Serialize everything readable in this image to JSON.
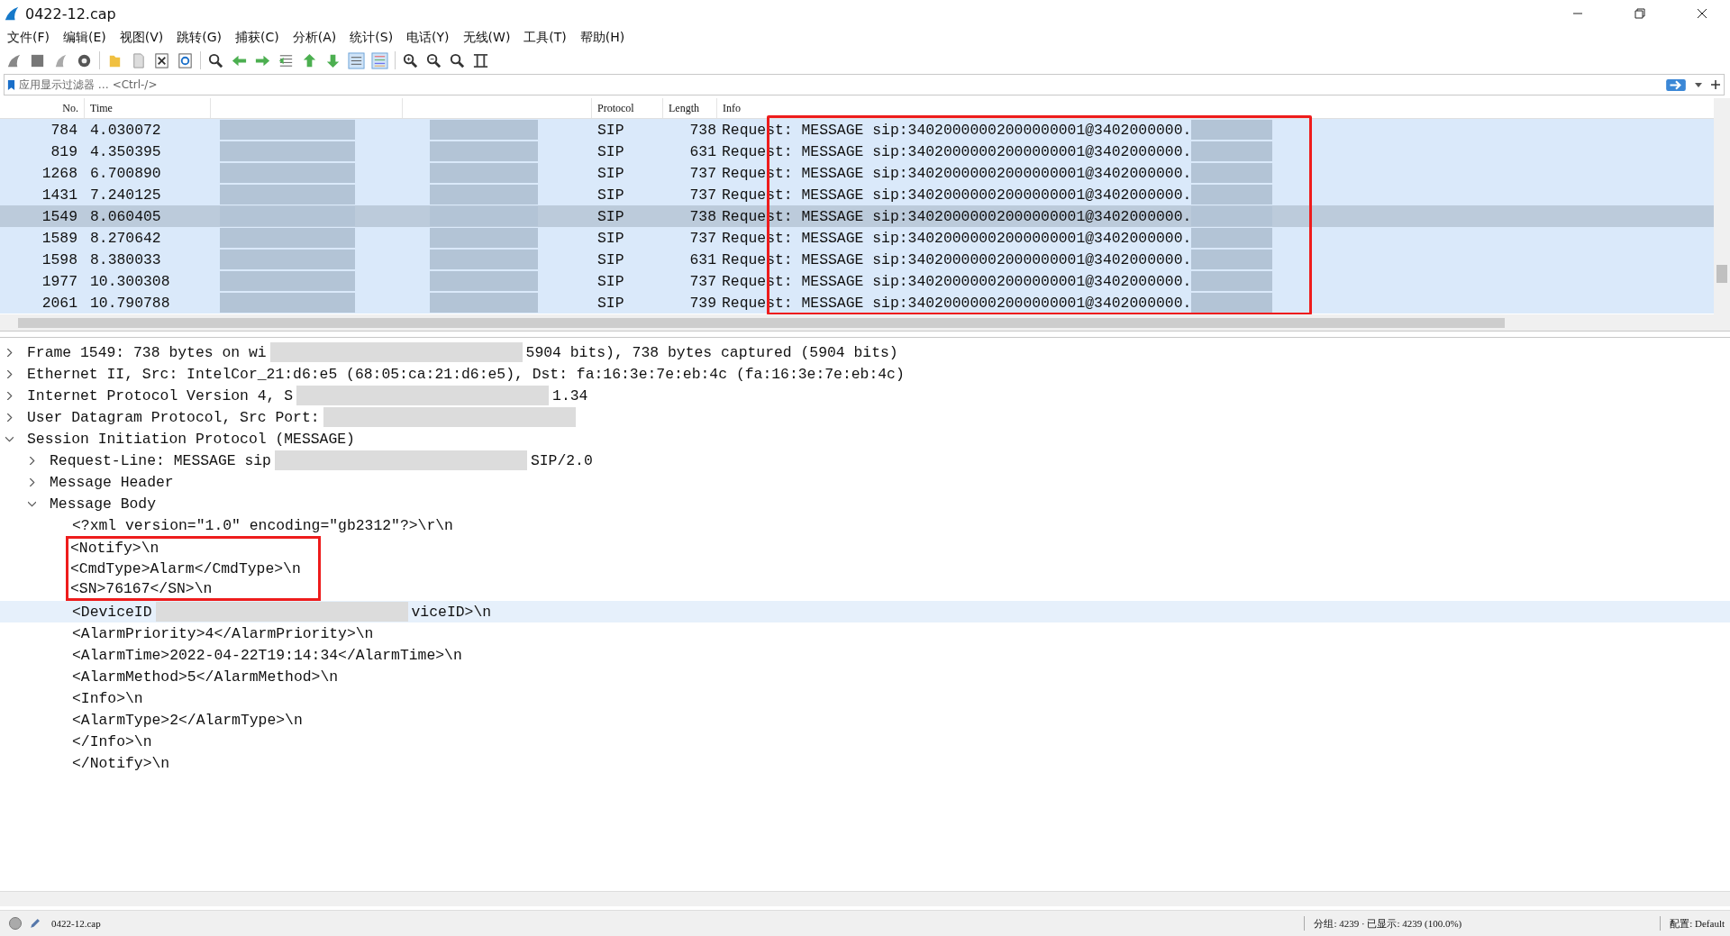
{
  "window": {
    "title": "0422-12.cap"
  },
  "menu": [
    "文件(F)",
    "编辑(E)",
    "视图(V)",
    "跳转(G)",
    "捕获(C)",
    "分析(A)",
    "统计(S)",
    "电话(Y)",
    "无线(W)",
    "工具(T)",
    "帮助(H)"
  ],
  "filter": {
    "placeholder": "应用显示过滤器 … <Ctrl-/>"
  },
  "packet_list": {
    "columns": [
      "No.",
      "Time",
      "Protocol",
      "Length",
      "Info"
    ],
    "rows": [
      {
        "no": "784",
        "time": "4.030072",
        "protocol": "SIP",
        "length": "738",
        "info": "Request: MESSAGE sip:34020000002000000001@3402000000.",
        "selected": false
      },
      {
        "no": "819",
        "time": "4.350395",
        "protocol": "SIP",
        "length": "631",
        "info": "Request: MESSAGE sip:34020000002000000001@3402000000.",
        "selected": false
      },
      {
        "no": "1268",
        "time": "6.700890",
        "protocol": "SIP",
        "length": "737",
        "info": "Request: MESSAGE sip:34020000002000000001@3402000000.",
        "selected": false
      },
      {
        "no": "1431",
        "time": "7.240125",
        "protocol": "SIP",
        "length": "737",
        "info": "Request: MESSAGE sip:34020000002000000001@3402000000.",
        "selected": false
      },
      {
        "no": "1549",
        "time": "8.060405",
        "protocol": "SIP",
        "length": "738",
        "info": "Request: MESSAGE sip:34020000002000000001@3402000000.",
        "selected": true
      },
      {
        "no": "1589",
        "time": "8.270642",
        "protocol": "SIP",
        "length": "737",
        "info": "Request: MESSAGE sip:34020000002000000001@3402000000.",
        "selected": false
      },
      {
        "no": "1598",
        "time": "8.380033",
        "protocol": "SIP",
        "length": "631",
        "info": "Request: MESSAGE sip:34020000002000000001@3402000000.",
        "selected": false
      },
      {
        "no": "1977",
        "time": "10.300308",
        "protocol": "SIP",
        "length": "737",
        "info": "Request: MESSAGE sip:34020000002000000001@3402000000.",
        "selected": false
      },
      {
        "no": "2061",
        "time": "10.790788",
        "protocol": "SIP",
        "length": "739",
        "info": "Request: MESSAGE sip:34020000002000000001@3402000000.",
        "selected": false
      }
    ]
  },
  "packet_details": [
    {
      "text": "Frame 1549: 738 bytes on wi",
      "redacted": true,
      "text_after": "5904 bits), 738 bytes captured (5904 bits)",
      "expanded": false
    },
    {
      "text": "Ethernet II, Src: IntelCor_21:d6:e5 (68:05:ca:21:d6:e5), Dst: fa:16:3e:7e:eb:4c (fa:16:3e:7e:eb:4c)",
      "expanded": false
    },
    {
      "text": "Internet Protocol Version 4, S",
      "redacted": true,
      "text_after": "1.34",
      "expanded": false
    },
    {
      "text": "User Datagram Protocol, Src Port:",
      "redacted": true,
      "expanded": false
    },
    {
      "text": "Session Initiation Protocol (MESSAGE)",
      "expanded": true,
      "children": [
        {
          "text": "Request-Line: MESSAGE sip",
          "redacted": true,
          "text_after": "SIP/2.0",
          "expanded": false
        },
        {
          "text": "Message Header",
          "expanded": false
        },
        {
          "text": "Message Body",
          "expanded": true,
          "children": [
            {
              "text": "<?xml version=\"1.0\" encoding=\"gb2312\"?>\\r\\n",
              "boxed": false,
              "highlighted": false
            },
            {
              "text": "<Notify>\\n",
              "boxed": true,
              "highlighted": false
            },
            {
              "text": "<CmdType>Alarm</CmdType>\\n",
              "boxed": true,
              "highlighted": false
            },
            {
              "text": "<SN>76167</SN>\\n",
              "boxed": true,
              "highlighted": false
            },
            {
              "text": "<DeviceID",
              "redacted": true,
              "text_after": "viceID>\\n",
              "boxed": false,
              "highlighted": true
            },
            {
              "text": "<AlarmPriority>4</AlarmPriority>\\n",
              "boxed": false,
              "highlighted": false
            },
            {
              "text": "<AlarmTime>2022-04-22T19:14:34</AlarmTime>\\n",
              "boxed": false,
              "highlighted": false
            },
            {
              "text": "<AlarmMethod>5</AlarmMethod>\\n",
              "boxed": false,
              "highlighted": false
            },
            {
              "text": "<Info>\\n",
              "boxed": false,
              "highlighted": false
            },
            {
              "text": "<AlarmType>2</AlarmType>\\n",
              "boxed": false,
              "highlighted": false
            },
            {
              "text": "</Info>\\n",
              "boxed": false,
              "highlighted": false
            },
            {
              "text": "</Notify>\\n",
              "boxed": false,
              "highlighted": false
            }
          ]
        }
      ]
    }
  ],
  "status_bar": {
    "file": "0422-12.cap",
    "counts": "分组: 4239 · 已显示: 4239 (100.0%)",
    "profile": "配置: Default"
  }
}
